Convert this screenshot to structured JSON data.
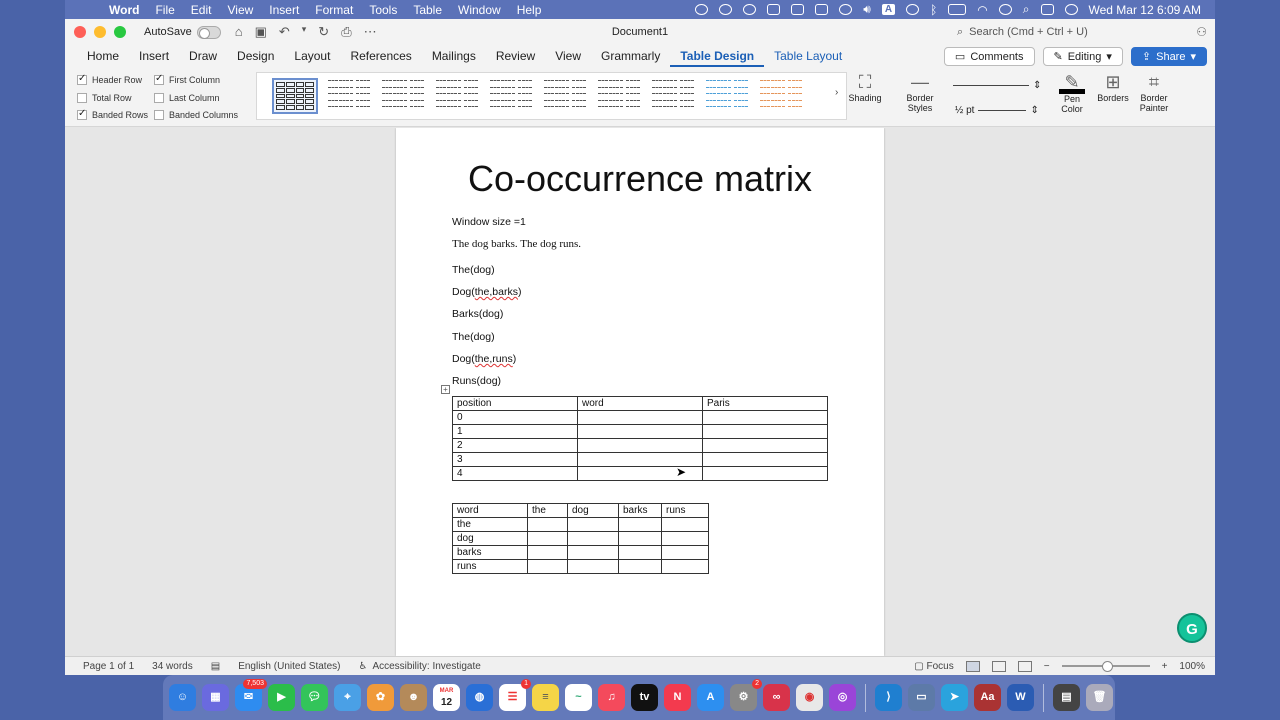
{
  "menubar": {
    "app": "Word",
    "items": [
      "File",
      "Edit",
      "View",
      "Insert",
      "Format",
      "Tools",
      "Table",
      "Window",
      "Help"
    ],
    "clock": "Wed Mar 12  6:09 AM",
    "ab": "A"
  },
  "titlebar": {
    "autosave_label": "AutoSave",
    "document_title": "Document1",
    "search_placeholder": "Search (Cmd + Ctrl + U)"
  },
  "tabs": [
    "Home",
    "Insert",
    "Draw",
    "Design",
    "Layout",
    "References",
    "Mailings",
    "Review",
    "View",
    "Grammarly",
    "Table Design",
    "Table Layout"
  ],
  "active_tab": "Table Design",
  "actions": {
    "comments": "Comments",
    "editing": "Editing",
    "share": "Share"
  },
  "ribbon": {
    "options": [
      {
        "label": "Header Row",
        "checked": true
      },
      {
        "label": "Total Row",
        "checked": false
      },
      {
        "label": "Banded Rows",
        "checked": true
      },
      {
        "label": "First Column",
        "checked": true
      },
      {
        "label": "Last Column",
        "checked": false
      },
      {
        "label": "Banded Columns",
        "checked": false
      }
    ],
    "shading": "Shading",
    "border_styles_1": "Border",
    "border_styles_2": "Styles",
    "pen_weight": "½ pt",
    "pen_color_1": "Pen",
    "pen_color_2": "Color",
    "borders": "Borders",
    "border_painter_1": "Border",
    "border_painter_2": "Painter"
  },
  "document": {
    "heading": "Co-occurrence matrix",
    "window_size": "Window size =1",
    "sentence": "The dog barks. The dog runs.",
    "lines": {
      "l1": "The(dog)",
      "l2a": "Dog(",
      "l2b": "the,barks",
      "l2c": ")",
      "l3": "Barks(dog)",
      "l4": "The(dog)",
      "l5a": "Dog(",
      "l5b": "the,runs",
      "l5c": ")",
      "l6": "Runs(dog)"
    },
    "table1": {
      "headers": [
        "position",
        "word",
        "Paris"
      ],
      "rows": [
        "0",
        "1",
        "2",
        "3",
        "4"
      ]
    },
    "table2": {
      "headers": [
        "word",
        "the",
        "dog",
        "barks",
        "runs"
      ],
      "rows": [
        "the",
        "dog",
        "barks",
        "runs"
      ]
    }
  },
  "statusbar": {
    "page": "Page 1 of 1",
    "words": "34 words",
    "language": "English (United States)",
    "accessibility": "Accessibility: Investigate",
    "focus": "Focus",
    "zoom": "100%"
  },
  "dock": {
    "mail_badge": "7,503",
    "calendar_month": "MAR",
    "calendar_day": "12",
    "reminders_badge": "1",
    "settings_badge": "2",
    "apple_tv": "tv"
  }
}
